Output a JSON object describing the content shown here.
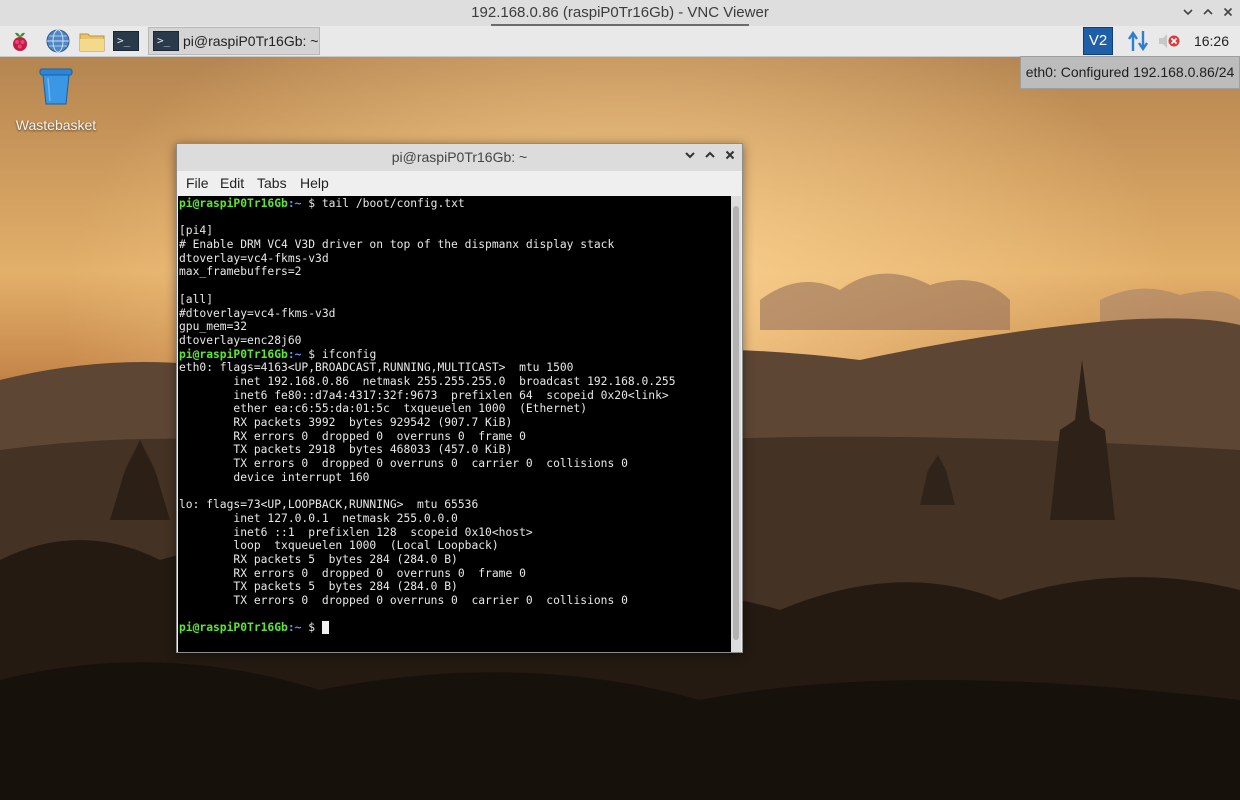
{
  "vnc": {
    "title": "192.168.0.86 (raspiP0Tr16Gb) - VNC Viewer"
  },
  "taskbar": {
    "icons": [
      "raspberry-menu-icon",
      "web-browser-icon",
      "file-manager-icon",
      "terminal-icon"
    ],
    "task_label": "pi@raspiP0Tr16Gb: ~",
    "tray_vnc_label": "V2",
    "clock": "16:26"
  },
  "notification": {
    "text": "eth0: Configured 192.168.0.86/24"
  },
  "desktop": {
    "wastebasket_label": "Wastebasket"
  },
  "terminal": {
    "title": "pi@raspiP0Tr16Gb: ~",
    "menu": [
      "File",
      "Edit",
      "Tabs",
      "Help"
    ],
    "prompt_user": "pi@raspiP0Tr16Gb",
    "prompt_path": ":~",
    "prompt_symbol": " $ ",
    "commands": [
      "tail /boot/config.txt",
      "ifconfig"
    ],
    "config_output": [
      "",
      "[pi4]",
      "# Enable DRM VC4 V3D driver on top of the dispmanx display stack",
      "dtoverlay=vc4-fkms-v3d",
      "max_framebuffers=2",
      "",
      "[all]",
      "#dtoverlay=vc4-fkms-v3d",
      "gpu_mem=32",
      "dtoverlay=enc28j60"
    ],
    "ifconfig_output": [
      "eth0: flags=4163<UP,BROADCAST,RUNNING,MULTICAST>  mtu 1500",
      "        inet 192.168.0.86  netmask 255.255.255.0  broadcast 192.168.0.255",
      "        inet6 fe80::d7a4:4317:32f:9673  prefixlen 64  scopeid 0x20<link>",
      "        ether ea:c6:55:da:01:5c  txqueuelen 1000  (Ethernet)",
      "        RX packets 3992  bytes 929542 (907.7 KiB)",
      "        RX errors 0  dropped 0  overruns 0  frame 0",
      "        TX packets 2918  bytes 468033 (457.0 KiB)",
      "        TX errors 0  dropped 0 overruns 0  carrier 0  collisions 0",
      "        device interrupt 160",
      "",
      "lo: flags=73<UP,LOOPBACK,RUNNING>  mtu 65536",
      "        inet 127.0.0.1  netmask 255.0.0.0",
      "        inet6 ::1  prefixlen 128  scopeid 0x10<host>",
      "        loop  txqueuelen 1000  (Local Loopback)",
      "        RX packets 5  bytes 284 (284.0 B)",
      "        RX errors 0  dropped 0  overruns 0  frame 0",
      "        TX packets 5  bytes 284 (284.0 B)",
      "        TX errors 0  dropped 0 overruns 0  carrier 0  collisions 0",
      ""
    ]
  }
}
